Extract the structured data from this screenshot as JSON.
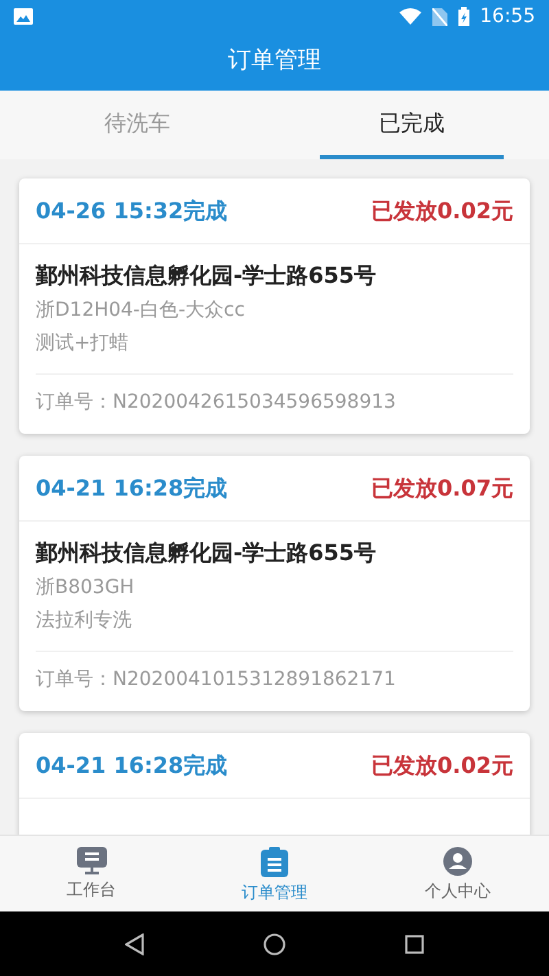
{
  "status_bar": {
    "time": "16:55"
  },
  "app_bar": {
    "title": "订单管理"
  },
  "tabs": [
    {
      "label": "待洗车",
      "selected": false
    },
    {
      "label": "已完成",
      "selected": true
    }
  ],
  "orders": [
    {
      "finished": "04-26 15:32完成",
      "payout": "已发放0.02元",
      "address": "鄞州科技信息孵化园-学士路655号",
      "car": "浙D12H04-白色-大众cc",
      "service": "测试+打蜡",
      "order_no": "订单号：N2020042615034596598913"
    },
    {
      "finished": "04-21 16:28完成",
      "payout": "已发放0.07元",
      "address": "鄞州科技信息孵化园-学士路655号",
      "car": "浙B803GH",
      "service": "法拉利专洗",
      "order_no": "订单号：N2020041015312891862171"
    },
    {
      "finished": "04-21 16:28完成",
      "payout": "已发放0.02元"
    }
  ],
  "bottom_nav": [
    {
      "label": "工作台",
      "kind": "desk",
      "selected": false
    },
    {
      "label": "订单管理",
      "kind": "orders",
      "selected": true
    },
    {
      "label": "个人中心",
      "kind": "profile",
      "selected": false
    }
  ]
}
